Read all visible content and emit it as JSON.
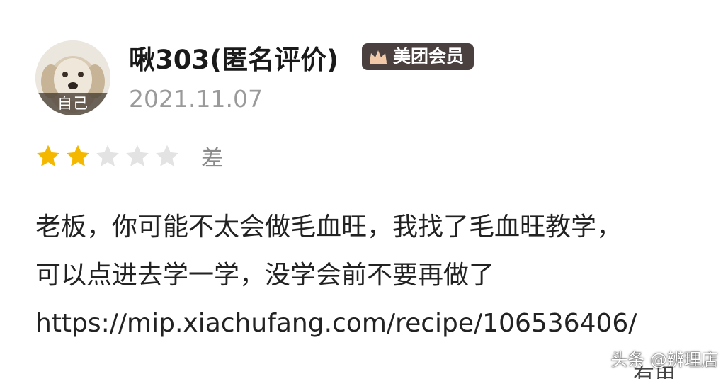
{
  "reviewer": {
    "name": "啾303(匿名评价)",
    "avatar_tag": "自己",
    "badge_icon": "crown-icon",
    "badge_label": "美团会员",
    "date": "2021.11.07"
  },
  "rating": {
    "stars_filled": 2,
    "stars_total": 5,
    "label": "差",
    "filled_color": "#f5b800",
    "empty_color": "#e3e3e3"
  },
  "review": {
    "lines": [
      "老板，你可能不太会做毛血旺，我找了毛血旺教学，",
      "可以点进去学一学，没学会前不要再做了",
      "https://mip.xiachufang.com/recipe/106536406/"
    ]
  },
  "footer": {
    "useful_label": "有用",
    "watermark": "头条 @辨理店"
  }
}
